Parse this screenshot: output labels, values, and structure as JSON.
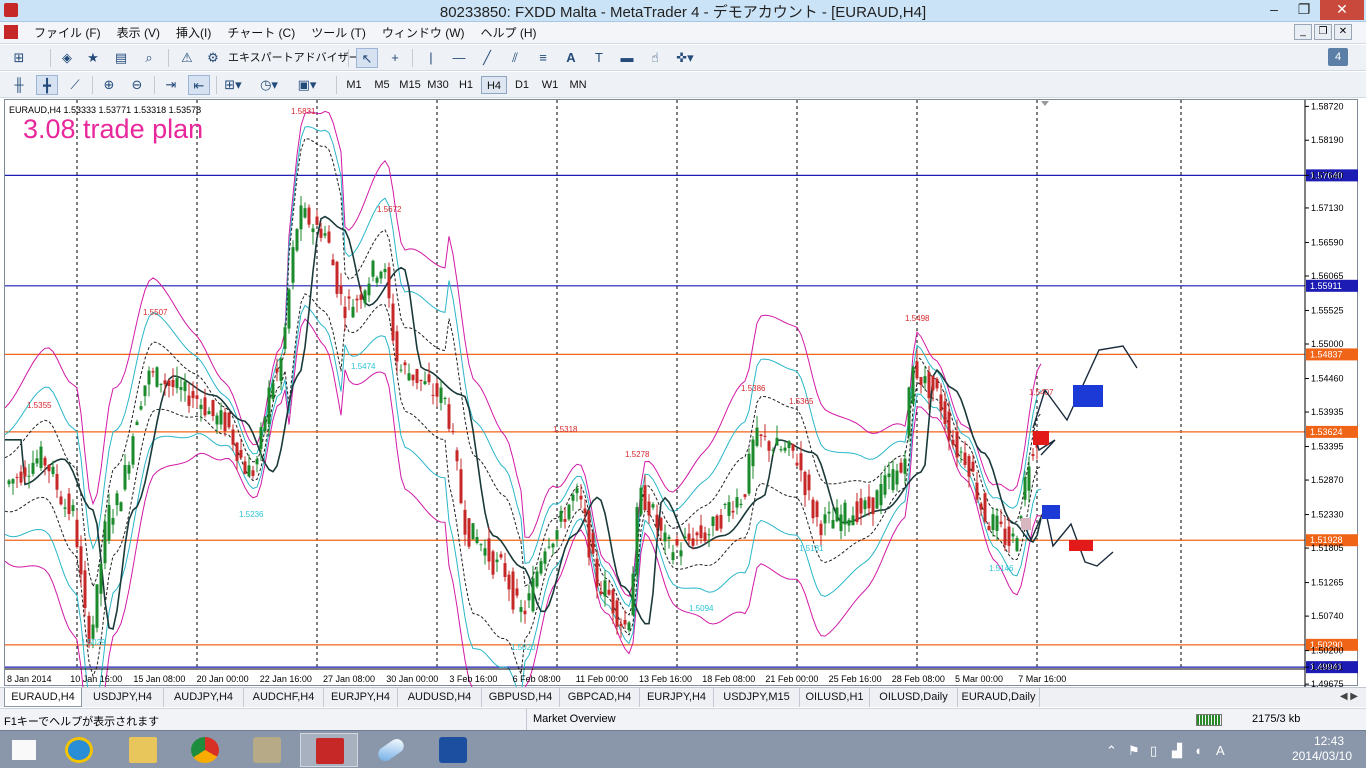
{
  "window": {
    "title": "80233850: FXDD Malta - MetaTrader 4 - デモアカウント - [EURAUD,H4]",
    "controls": [
      "–",
      "❐",
      "✕"
    ]
  },
  "menu": [
    "ファイル (F)",
    "表示 (V)",
    "挿入(I)",
    "チャート (C)",
    "ツール (T)",
    "ウィンドウ (W)",
    "ヘルプ (H)"
  ],
  "toolbar1": {
    "expert_advisor_label": "エキスパートアドバイザー",
    "text_tool_label": "A"
  },
  "timeframes": [
    "M1",
    "M5",
    "M15",
    "M30",
    "H1",
    "H4",
    "D1",
    "W1",
    "MN"
  ],
  "active_timeframe": "H4",
  "mt_badge": "4",
  "chart_data": {
    "type": "candlestick",
    "symbol_header": "EURAUD,H4  1.53333 1.53771 1.53318 1.53578",
    "annotation_title": "3.08 trade plan",
    "price_axis_ticks": [
      "1.58720",
      "1.58190",
      "1.57640",
      "1.57130",
      "1.56590",
      "1.56065",
      "1.55525",
      "1.55000",
      "1.54460",
      "1.53935",
      "1.53395",
      "1.52870",
      "1.52330",
      "1.51805",
      "1.51265",
      "1.50740",
      "1.50200",
      "1.49941",
      "1.49675"
    ],
    "price_range": [
      1.4963,
      1.5882
    ],
    "time_axis_labels": [
      "8 Jan 2014",
      "10 Jan 16:00",
      "15 Jan 08:00",
      "20 Jan 00:00",
      "22 Jan 16:00",
      "27 Jan 08:00",
      "30 Jan 00:00",
      "3 Feb 16:00",
      "6 Feb 08:00",
      "11 Feb 00:00",
      "13 Feb 16:00",
      "18 Feb 08:00",
      "21 Feb 00:00",
      "25 Feb 16:00",
      "28 Feb 08:00",
      "5 Mar 00:00",
      "7 Mar 16:00"
    ],
    "horizontal_lines": [
      {
        "price": 1.5764,
        "label": "1.57640",
        "color": "#1c1cb4"
      },
      {
        "price": 1.55911,
        "label": "1.55911",
        "color": "#1c1cb4"
      },
      {
        "price": 1.54837,
        "label": "1.54837",
        "color": "#f06418"
      },
      {
        "price": 1.53624,
        "label": "1.53624",
        "color": "#f06418"
      },
      {
        "price": 1.51928,
        "label": "1.51928",
        "color": "#f06418"
      },
      {
        "price": 1.5029,
        "label": "1.50290",
        "color": "#f06418"
      },
      {
        "price": 1.49941,
        "label": "1.49941",
        "color": "#1c1cb4"
      }
    ],
    "swing_labels": [
      {
        "text": "1.5831",
        "color": "#d6282d"
      },
      {
        "text": "1.5672",
        "color": "#d6282d"
      },
      {
        "text": "1.5507",
        "color": "#d6282d"
      },
      {
        "text": "1.5355",
        "color": "#d6282d"
      },
      {
        "text": "1.5474",
        "color": "#2ac4d4"
      },
      {
        "text": "1.5236",
        "color": "#2ac4d4"
      },
      {
        "text": "1.5029",
        "color": "#2ac4d4"
      },
      {
        "text": "1.5318",
        "color": "#d6282d"
      },
      {
        "text": "1.5278",
        "color": "#d6282d"
      },
      {
        "text": "1.5386",
        "color": "#d6282d"
      },
      {
        "text": "1.5365",
        "color": "#d6282d"
      },
      {
        "text": "1.5498",
        "color": "#d6282d"
      },
      {
        "text": "1.5407",
        "color": "#d6282d"
      },
      {
        "text": "1.5181",
        "color": "#2ac4d4"
      },
      {
        "text": "1.5094",
        "color": "#2ac4d4"
      },
      {
        "text": "1.5020",
        "color": "#2ac4d4"
      },
      {
        "text": "1.5146",
        "color": "#2ac4d4"
      }
    ],
    "colors": {
      "bull": "#1b8a2b",
      "bear": "#c62828",
      "outer_band": "#d21aa6",
      "inner_band": "#2ab7c9",
      "ma": "#1a3a3a",
      "grid": "#000000",
      "annotation": "#e8279b"
    }
  },
  "chart_tabs": [
    "EURAUD,H4",
    "USDJPY,H4",
    "AUDJPY,H4",
    "AUDCHF,H4",
    "EURJPY,H4",
    "AUDUSD,H4",
    "GBPUSD,H4",
    "GBPCAD,H4",
    "EURJPY,H4",
    "USDJPY,M15",
    "OILUSD,H1",
    "OILUSD,Daily",
    "EURAUD,Daily"
  ],
  "status": {
    "help": "F1キーでヘルプが表示されます",
    "profile": "Market Overview",
    "traffic": "2175/3 kb"
  },
  "taskbar": {
    "time": "12:43",
    "date": "2014/03/10",
    "ime": "A"
  }
}
